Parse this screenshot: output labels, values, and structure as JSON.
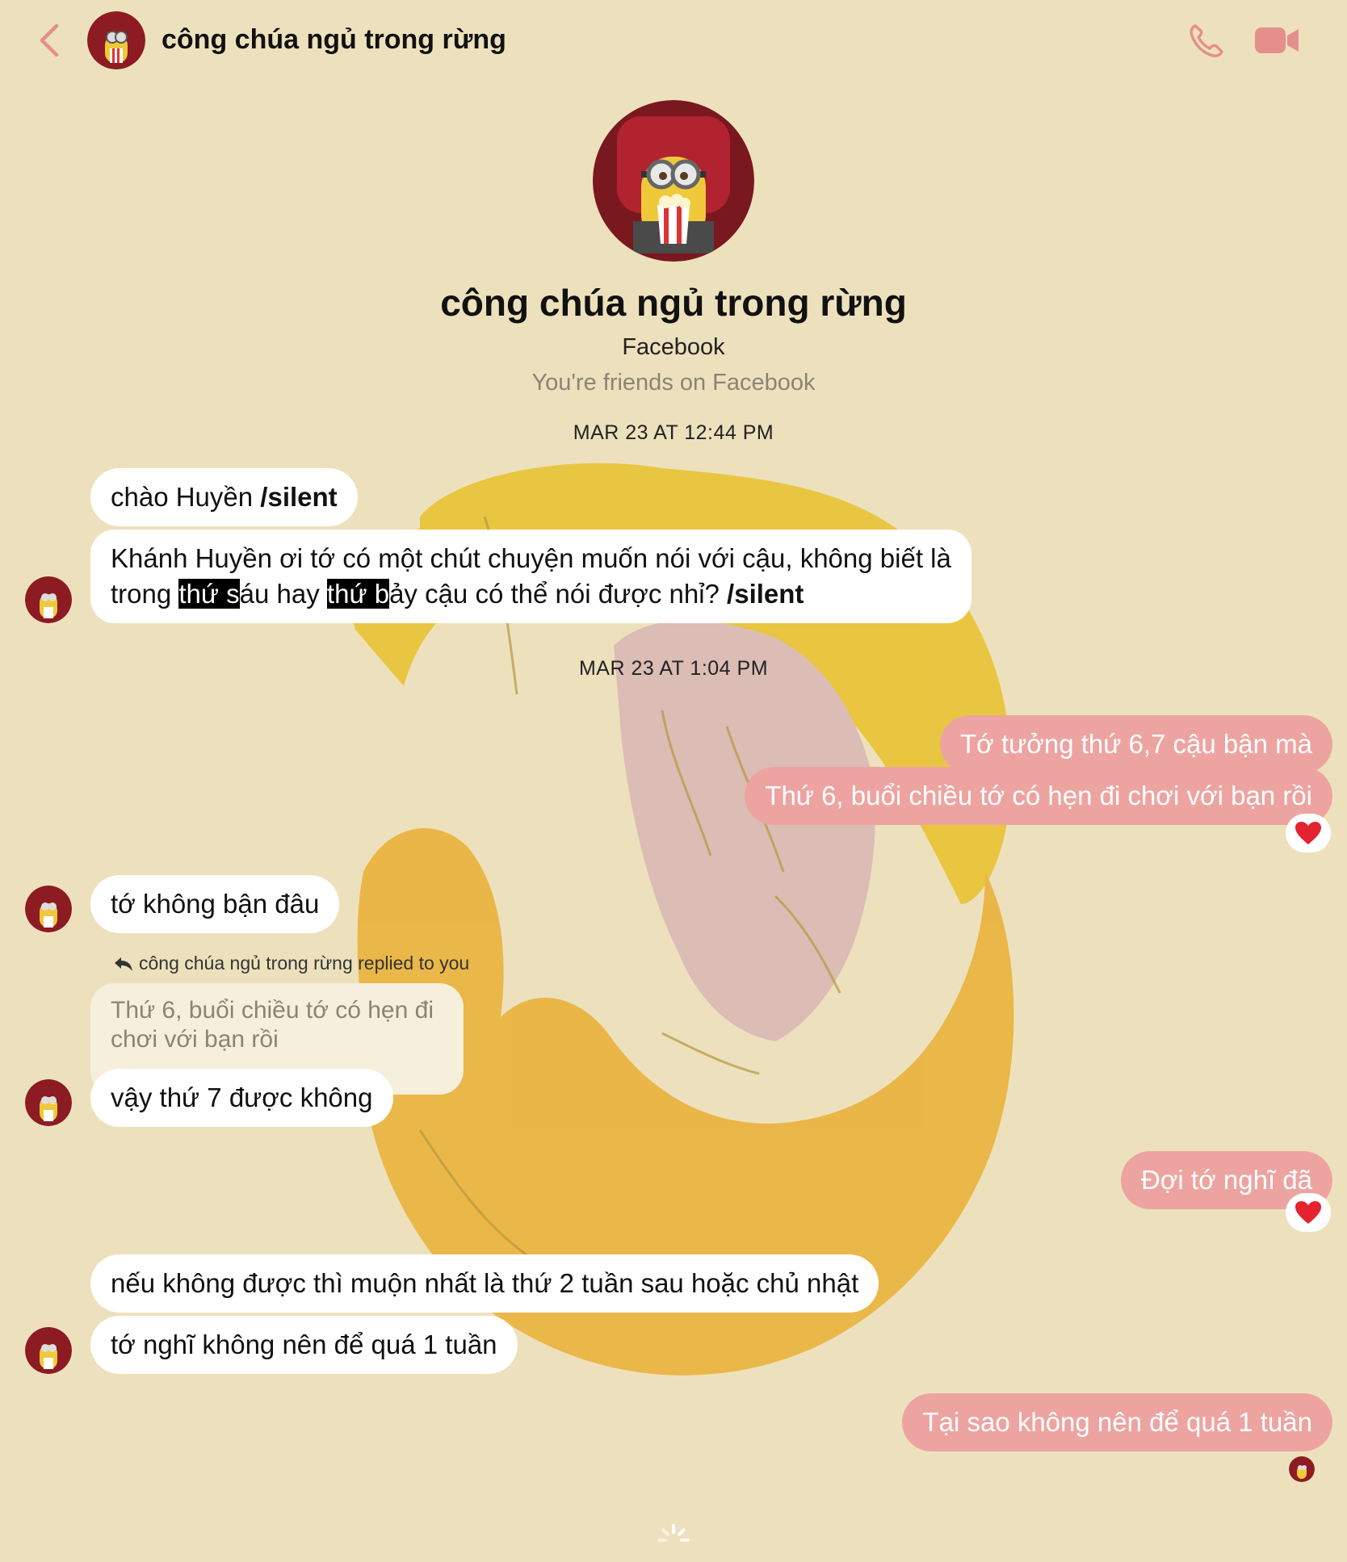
{
  "header": {
    "title": "công chúa ngủ trong rừng",
    "back_icon": "chevron-left-icon",
    "call_icon": "phone-icon",
    "video_icon": "video-camera-icon",
    "accent_color": "#e58f8c"
  },
  "profile": {
    "name": "công chúa ngủ trong rừng",
    "source": "Facebook",
    "relationship": "You're friends on Facebook"
  },
  "timestamps": {
    "first": "MAR 23 AT 12:44 PM",
    "second": "MAR 23 AT 1:04 PM"
  },
  "messages": {
    "m1": {
      "text": "chào Huyền ",
      "tag": "/silent"
    },
    "m2": {
      "line1": "Khánh Huyền ơi tớ có một chút chuyện muốn nói với cậu, không biết là",
      "p1": "trong ",
      "h1": "thứ s",
      "p2": "áu hay ",
      "h2": "thứ b",
      "p3": "ảy cậu có thể nói được nhỉ? ",
      "tag": "/silent"
    },
    "m3": {
      "text": "Tớ tưởng thứ 6,7 cậu bận mà"
    },
    "m4": {
      "text": "Thứ 6, buổi chiều tớ có hẹn đi chơi với bạn rồi",
      "reaction": "heart"
    },
    "m5": {
      "text": "tớ không bận đâu"
    },
    "reply": {
      "label": "công chúa ngủ trong rừng replied to you",
      "quoted": "Thứ 6, buổi chiều tớ có hẹn đi chơi với bạn rồi"
    },
    "m6": {
      "text": "vậy thứ 7 được không"
    },
    "m7": {
      "text": "Đợi tớ nghĩ đã",
      "reaction": "heart"
    },
    "m8": {
      "text": "nếu không được thì muộn nhất là thứ 2 tuần sau hoặc chủ nhật"
    },
    "m9": {
      "text": "tớ nghĩ không nên để quá 1 tuần"
    },
    "m10": {
      "text": "Tại sao không nên để quá 1 tuần"
    }
  },
  "colors": {
    "background": "#ede1bd",
    "incoming_bubble": "#ffffff",
    "outgoing_bubble": "#eda4a1"
  }
}
